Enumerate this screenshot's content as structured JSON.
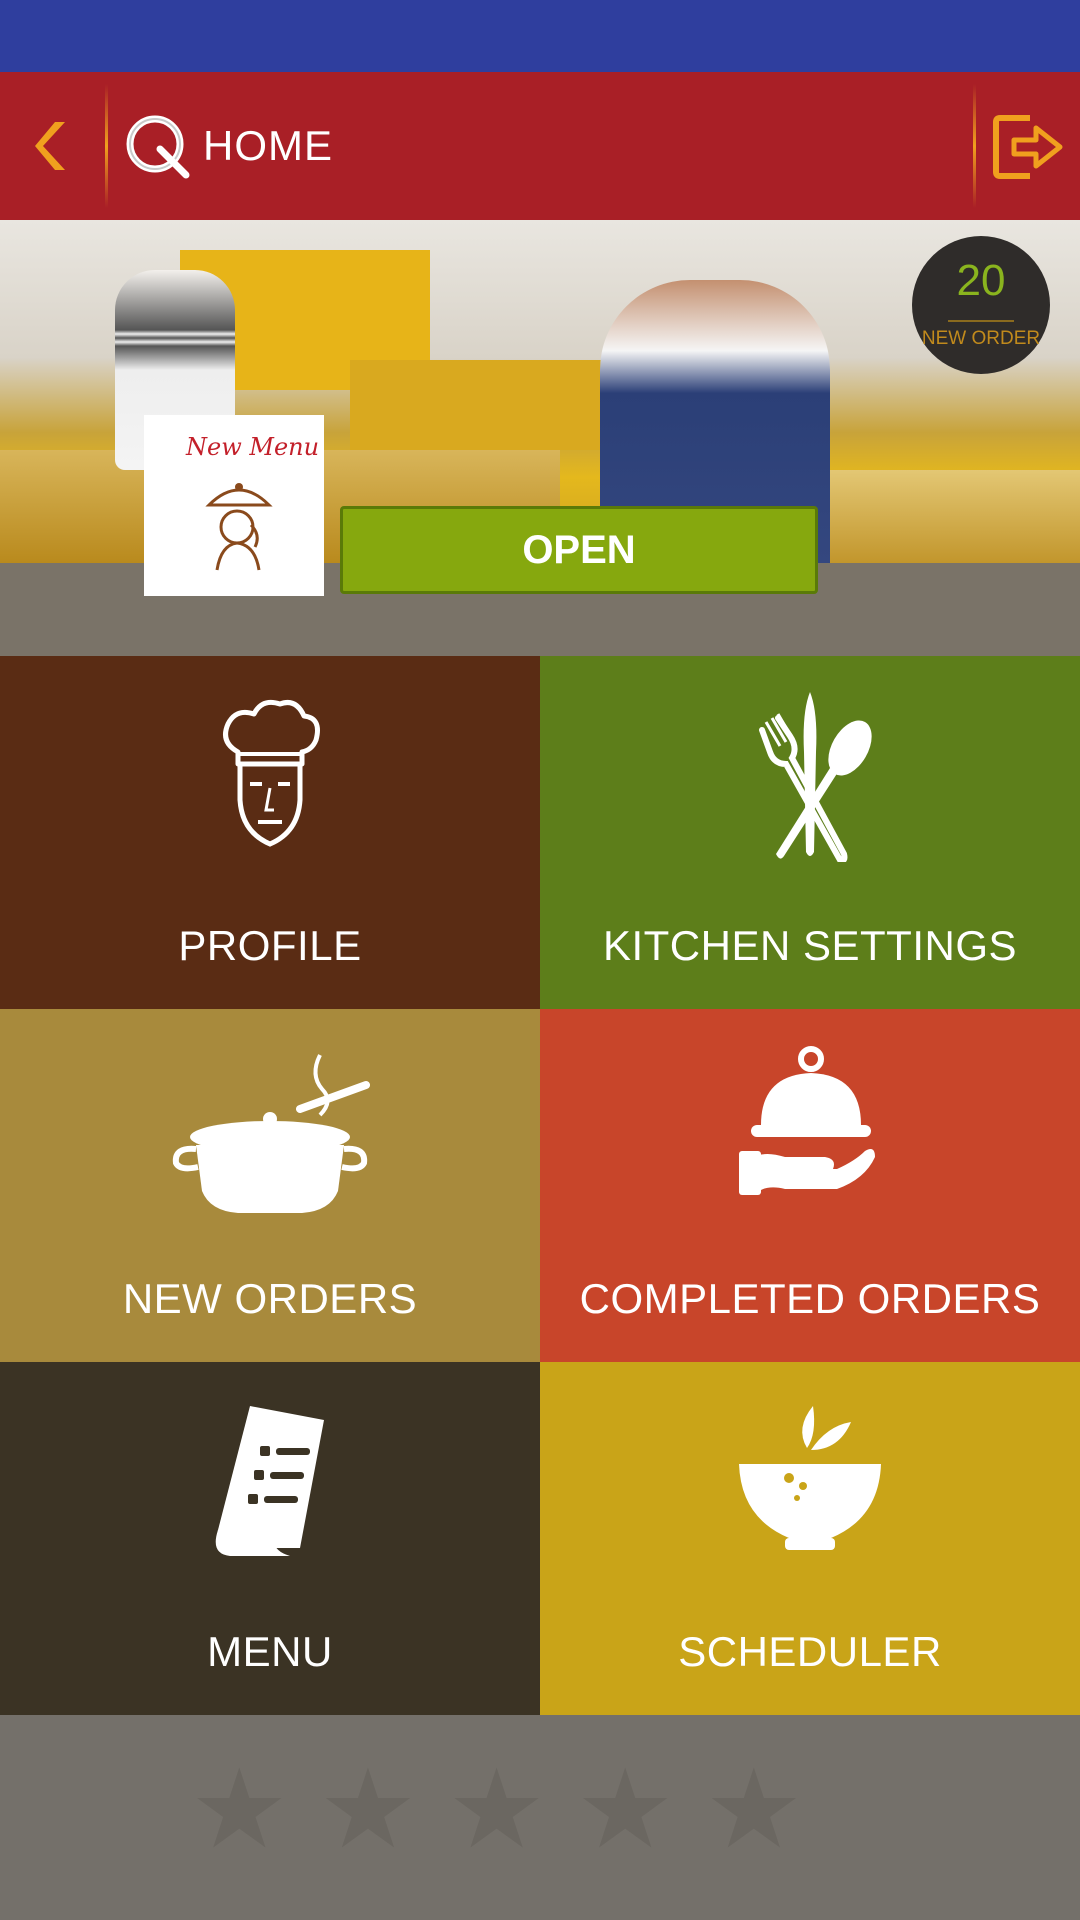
{
  "app_bar": {
    "title": "HOME"
  },
  "hero": {
    "badge_count": "20",
    "badge_label": "NEW ORDER",
    "menu_thumbnail_title": "New Menu",
    "open_button_label": "OPEN"
  },
  "tiles": [
    {
      "label": "PROFILE",
      "icon": "chef-hat-icon",
      "color": "#5a2c14"
    },
    {
      "label": "KITCHEN SETTINGS",
      "icon": "fork-spoon-icon",
      "color": "#5d7e1a"
    },
    {
      "label": "NEW ORDERS",
      "icon": "cooking-pot-icon",
      "color": "#a88a3c"
    },
    {
      "label": "COMPLETED ORDERS",
      "icon": "cloche-icon",
      "color": "#c8452a"
    },
    {
      "label": "MENU",
      "icon": "menu-list-icon",
      "color": "#3b3324"
    },
    {
      "label": "SCHEDULER",
      "icon": "soup-bowl-icon",
      "color": "#c9a418"
    }
  ],
  "colors": {
    "status_bar": "#2f3e9e",
    "app_bar": "#a91f26",
    "accent": "#f0a01e",
    "open_button": "#86a80e"
  }
}
